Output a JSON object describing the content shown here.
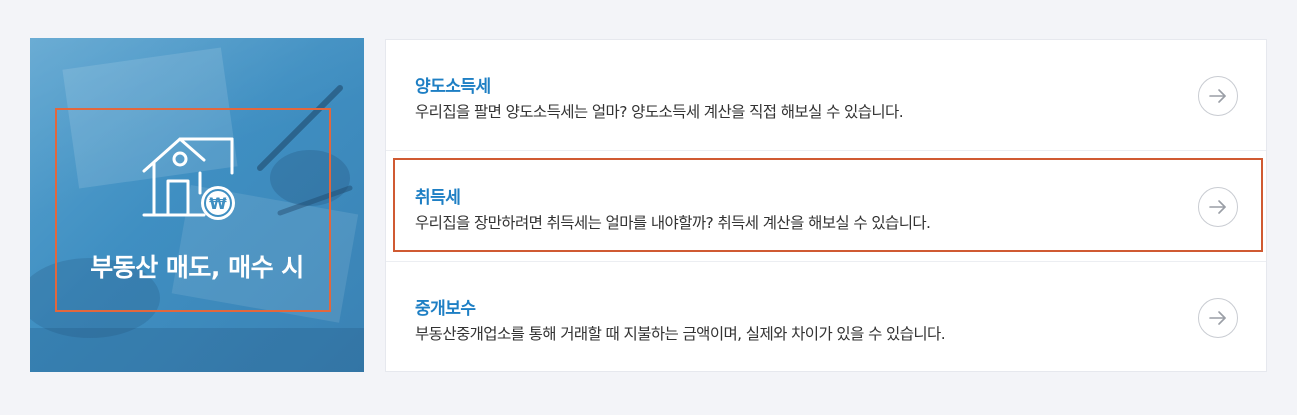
{
  "banner": {
    "title": "부동산 매도, 매수 시",
    "icon": "house-won-icon"
  },
  "items": [
    {
      "title": "양도소득세",
      "description": "우리집을 팔면 양도소득세는 얼마? 양도소득세 계산을 직접 해보실 수 있습니다.",
      "icon": "arrow-right-circle-icon"
    },
    {
      "title": "취득세",
      "description": "우리집을 장만하려면 취득세는 얼마를 내야할까? 취득세 계산을 해보실 수 있습니다.",
      "icon": "arrow-right-circle-icon",
      "highlighted": true
    },
    {
      "title": "중개보수",
      "description": "부동산중개업소를 통해 거래할 때 지불하는 금액이며, 실제와 차이가 있을 수 있습니다.",
      "icon": "arrow-right-circle-icon"
    }
  ],
  "colors": {
    "accent_blue": "#1e7fc4",
    "banner_blue": "#3f8fc2",
    "highlight_border": "#d05a32"
  }
}
